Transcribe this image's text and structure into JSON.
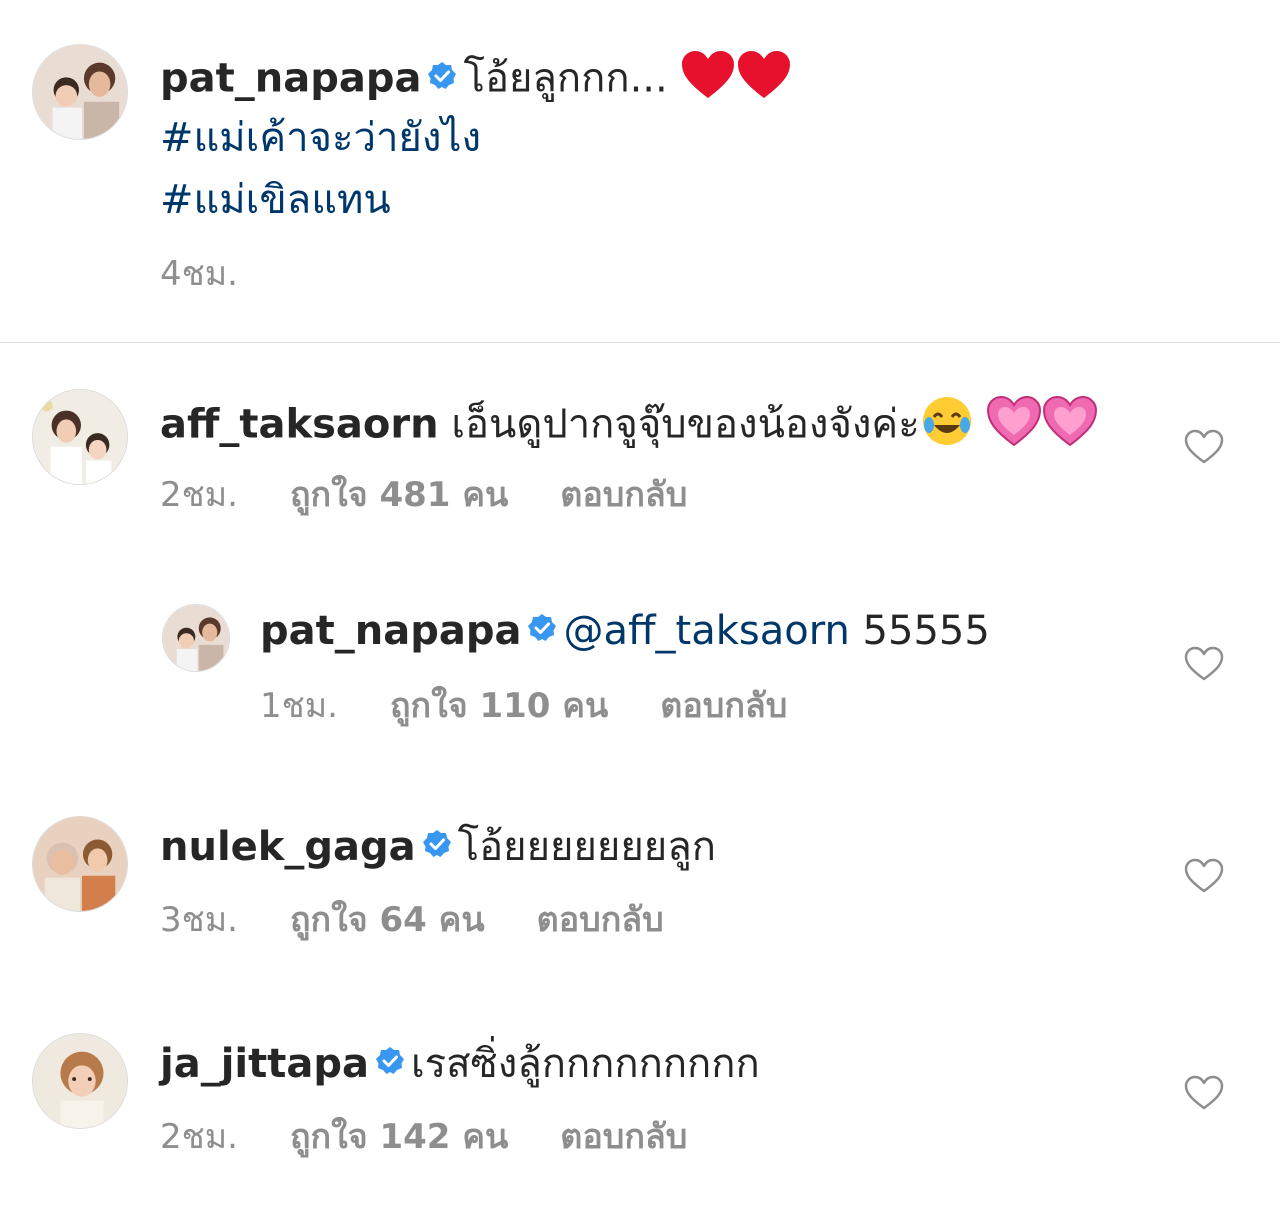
{
  "caption": {
    "username": "pat_napapa",
    "text": "โอ้ยลูกกก...",
    "emojis": [
      "red-heart",
      "red-heart"
    ],
    "hashtags": [
      "#แม่เค้าจะว่ายังไง",
      "#แม่เขิลแทน"
    ],
    "time": "4ชม."
  },
  "comments": [
    {
      "username": "aff_taksaorn",
      "text": "เอ็นดูปากจูจุ๊บของน้องจังค่ะ",
      "emojis": [
        "tears-of-joy",
        "pink-heart",
        "pink-heart"
      ],
      "time": "2ชม.",
      "likes": "ถูกใจ 481 คน",
      "reply": "ตอบกลับ"
    },
    {
      "username": "pat_napapa",
      "mention": "@aff_taksaorn",
      "text": " 55555",
      "time": "1ชม.",
      "likes": "ถูกใจ 110 คน",
      "reply": "ตอบกลับ"
    },
    {
      "username": "nulek_gaga",
      "text": "โอ้ยยยยยยยลูก",
      "time": "3ชม.",
      "likes": "ถูกใจ 64 คน",
      "reply": "ตอบกลับ"
    },
    {
      "username": "ja_jittapa",
      "text": "เรสซิ่งลู้กกกกกกกกก",
      "time": "2ชม.",
      "likes": "ถูกใจ 142 คน",
      "reply": "ตอบกลับ"
    }
  ],
  "colors": {
    "verified": "#3897f0",
    "hashtag": "#00376b",
    "secondary_text": "#8e8e8e",
    "divider": "#dbdbdb"
  }
}
